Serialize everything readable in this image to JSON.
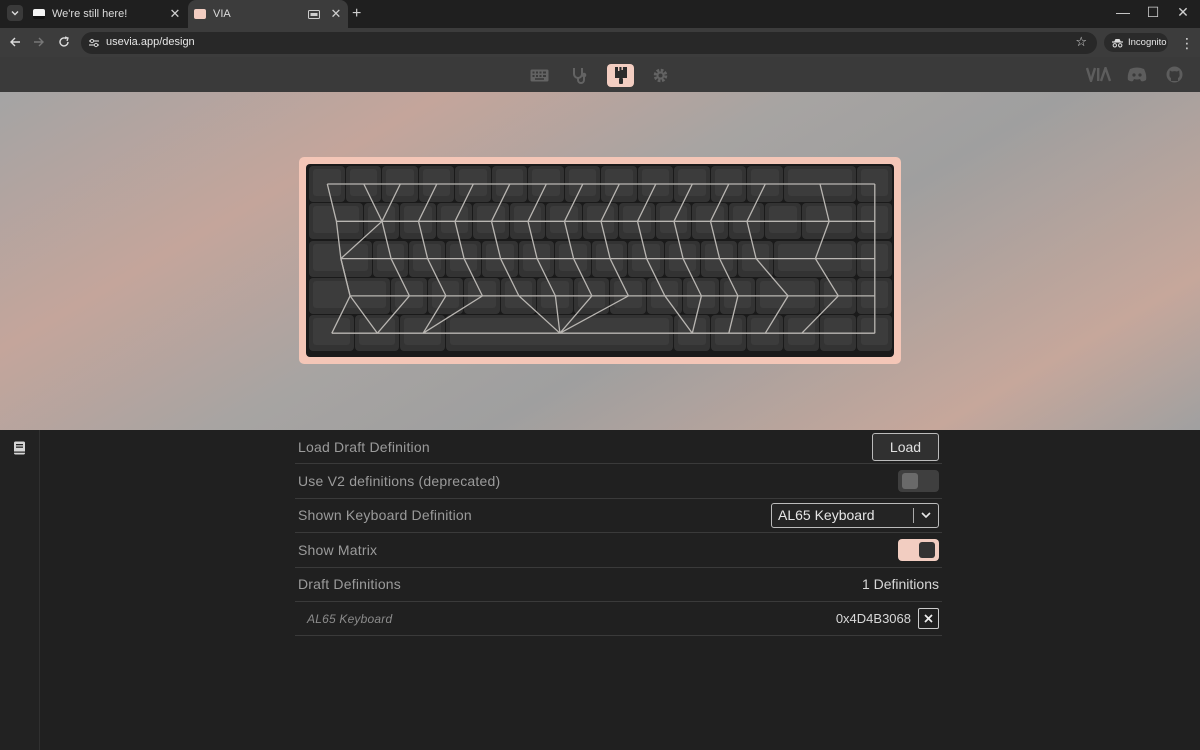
{
  "browser": {
    "tabs": [
      {
        "title": "We're still here!",
        "active": false
      },
      {
        "title": "VIA",
        "active": true
      }
    ],
    "url": "usevia.app/design",
    "incognito_label": "Incognito"
  },
  "app": {
    "nav": [
      {
        "name": "keyboard-icon",
        "active": false
      },
      {
        "name": "stethoscope-icon",
        "active": false
      },
      {
        "name": "paint-brush-icon",
        "active": true
      },
      {
        "name": "gear-icon",
        "active": false
      }
    ],
    "brand_label": "VIA",
    "colors": {
      "accent": "#f2cdc1",
      "case": "#f4c6b7",
      "background": "#202020"
    }
  },
  "settings": {
    "load_draft": {
      "label": "Load Draft Definition",
      "button": "Load"
    },
    "use_v2": {
      "label": "Use V2 definitions (deprecated)",
      "enabled": false
    },
    "shown_definition": {
      "label": "Shown Keyboard Definition",
      "value": "AL65 Keyboard"
    },
    "show_matrix": {
      "label": "Show Matrix",
      "enabled": true
    },
    "draft_definitions": {
      "label": "Draft Definitions",
      "count": "1 Definitions"
    },
    "definitions": [
      {
        "name": "AL65 Keyboard",
        "vendor_product_id": "0x4D4B3068"
      }
    ]
  }
}
